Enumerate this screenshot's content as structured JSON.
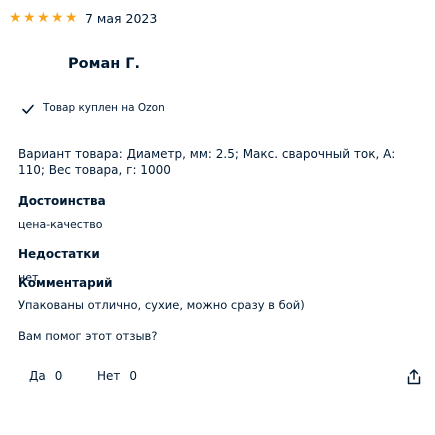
{
  "review": {
    "rating": 5,
    "star_glyph": "★",
    "star_color": "#f9a51a",
    "date": "7 мая 2023",
    "author": "Роман Г.",
    "purchased_badge": "Товар куплен на Ozon",
    "purchased_icon": "check-icon",
    "variant_line1": "Вариант товара: Диаметр, мм: 2.5; Макс. сварочный ток, А:",
    "variant_line2": "110; Вес товара, г: 1000",
    "sections": [
      {
        "heading": "Достоинства",
        "text": "цена-качество"
      },
      {
        "heading": "Недостатки",
        "text": "нет"
      },
      {
        "heading": "Комментарий",
        "text": "Упакованы отлично, сухие, можно сразу в бой)"
      }
    ],
    "helpful_question": "Вам помог этот отзыв?",
    "yes_label": "Да",
    "yes_count": "0",
    "no_label": "Нет",
    "no_count": "0",
    "share_icon": "share-icon"
  }
}
